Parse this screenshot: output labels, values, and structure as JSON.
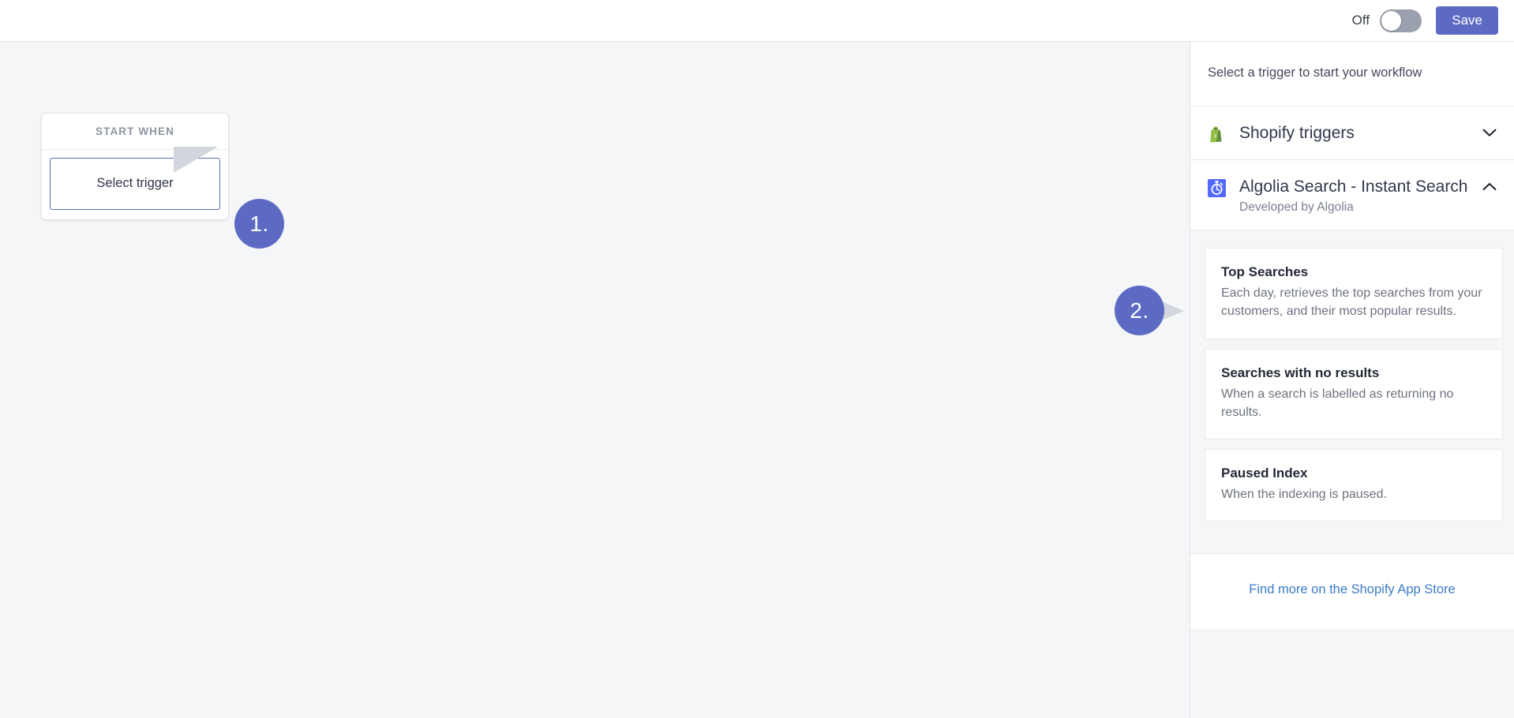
{
  "topbar": {
    "toggle_label": "Off",
    "toggle_state": "off",
    "save_label": "Save",
    "save_color": "#5c6ac4"
  },
  "canvas": {
    "node": {
      "header_label": "START WHEN",
      "trigger_button_label": "Select trigger"
    },
    "annotations": [
      {
        "label": "1.",
        "color": "#5c6ac4"
      },
      {
        "label": "2.",
        "color": "#5c6ac4"
      }
    ]
  },
  "sidebar": {
    "intro": "Select a trigger to start your workflow",
    "groups": [
      {
        "title": "Shopify triggers",
        "subtitle": "",
        "icon": "shopify-bag-icon",
        "expanded": false,
        "chevron": "chevron-down-icon"
      },
      {
        "title": "Algolia Search - Instant Search",
        "subtitle": "Developed by Algolia",
        "icon": "algolia-stopwatch-icon",
        "expanded": true,
        "chevron": "chevron-up-icon"
      }
    ],
    "triggers": [
      {
        "title": "Top Searches",
        "description": "Each day, retrieves the top searches from your customers, and their most popular results."
      },
      {
        "title": "Searches with no results",
        "description": "When a search is labelled as returning no results."
      },
      {
        "title": "Paused Index",
        "description": "When the indexing is paused."
      }
    ],
    "footer_link": "Find more on the Shopify App Store",
    "footer_link_color": "#3a7dc7"
  }
}
